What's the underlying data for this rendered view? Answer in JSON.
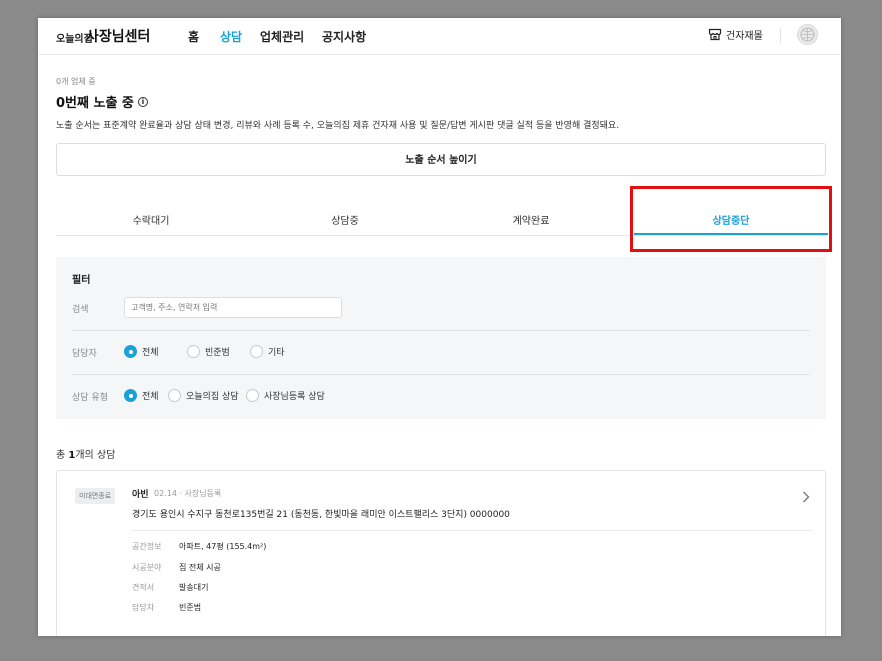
{
  "header": {
    "logo_small": "오늘의집",
    "logo_big": "사장님센터",
    "nav": [
      {
        "label": "홈"
      },
      {
        "label": "상담"
      },
      {
        "label": "업체관리"
      },
      {
        "label": "공지사항"
      }
    ],
    "active_nav": "상담",
    "materials_label": "건자재몰"
  },
  "exposure": {
    "count_text": "0개 업체 중",
    "title": "0번째 노출 중",
    "description": "노출 순서는 표준계약 완료율과 상담 상태 변경, 리뷰와 사례 등록 수, 오늘의집 제휴 건자재 사용 및 질문/답변 게시판 댓글 실적 등을 반영해 결정돼요.",
    "raise_button": "노출 순서 높이기"
  },
  "tabs": [
    {
      "label": "수락대기"
    },
    {
      "label": "상담중"
    },
    {
      "label": "계약완료"
    },
    {
      "label": "상담중단"
    }
  ],
  "active_tab": "상담중단",
  "filter": {
    "title": "필터",
    "search": {
      "label": "검색",
      "placeholder": "고객명, 주소, 연락처 입력"
    },
    "manager": {
      "label": "담당자",
      "options": [
        {
          "label": "전체",
          "selected": true
        },
        {
          "label": "빈준범",
          "selected": false
        },
        {
          "label": "기타",
          "selected": false
        }
      ]
    },
    "consult_type": {
      "label": "상담 유형",
      "options": [
        {
          "label": "전체",
          "selected": true
        },
        {
          "label": "오늘의집 상담",
          "selected": false
        },
        {
          "label": "사장님등록 상담",
          "selected": false
        }
      ]
    }
  },
  "list": {
    "total_prefix": "총 ",
    "total_count": "1",
    "total_suffix": "개의 상담",
    "items": [
      {
        "badge": "미대면종료",
        "customer_name": "아빈",
        "meta": "02.14 · 사장님등록",
        "address": "경기도 용인시 수지구 동천로135번길 21 (동천동, 한빛마을 래미안 이스트팰리스 3단지) 0000000",
        "details": [
          {
            "label": "공간정보",
            "value": "아파트, 47평 (155.4m²)"
          },
          {
            "label": "시공분야",
            "value": "집 전체 시공"
          },
          {
            "label": "견적서",
            "value": "발송대기"
          },
          {
            "label": "담당자",
            "value": "빈준범"
          }
        ]
      }
    ]
  },
  "colors": {
    "accent": "#1aa1d8",
    "highlight_box": "#e01010"
  }
}
